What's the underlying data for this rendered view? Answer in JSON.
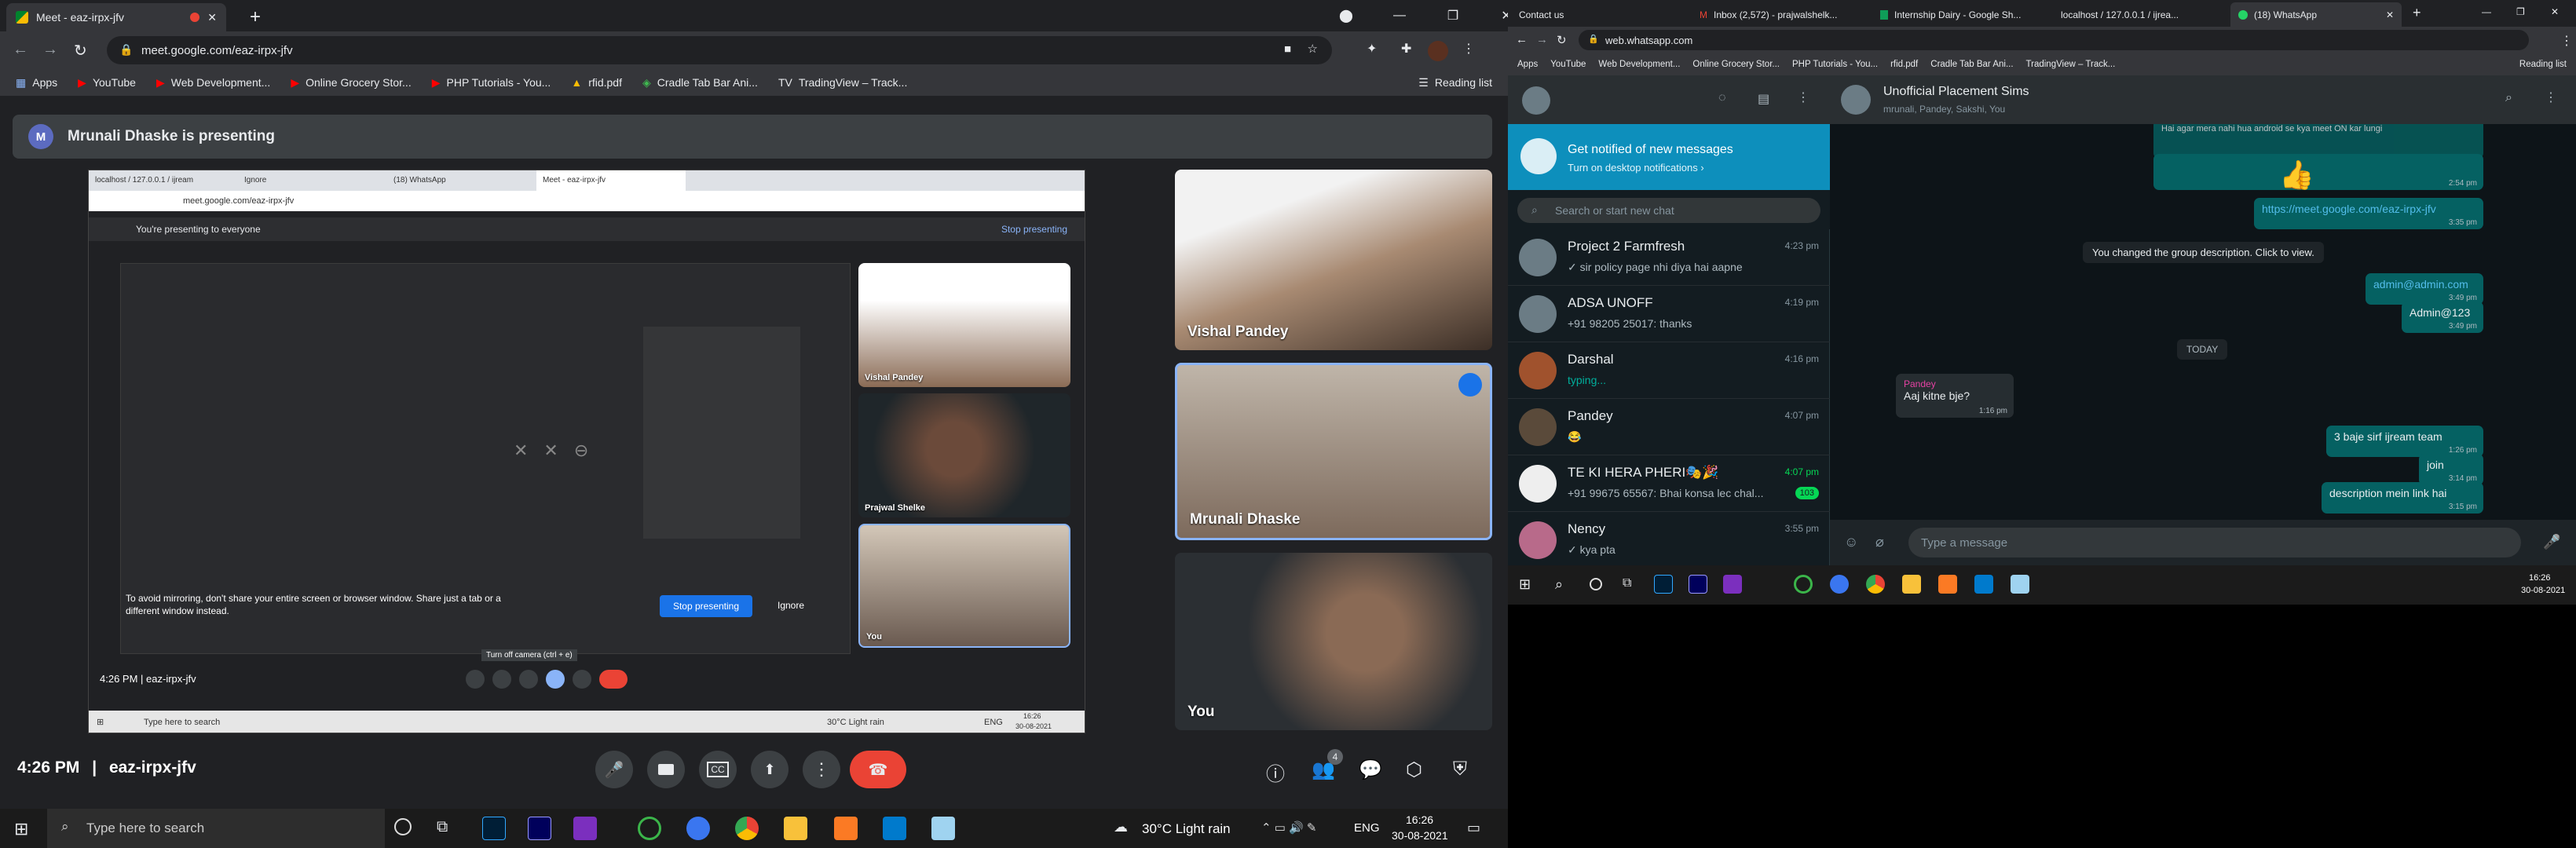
{
  "left_browser": {
    "tab_title": "Meet - eaz-irpx-jfv",
    "url": "meet.google.com/eaz-irpx-jfv",
    "reading_list": "Reading list",
    "bookmarks": [
      {
        "label": "Apps",
        "icon": "apps-grid-icon"
      },
      {
        "label": "YouTube",
        "icon": "youtube-icon"
      },
      {
        "label": "Web Development...",
        "icon": "youtube-icon"
      },
      {
        "label": "Online Grocery Stor...",
        "icon": "youtube-icon"
      },
      {
        "label": "PHP Tutorials - You...",
        "icon": "youtube-icon"
      },
      {
        "label": "rfid.pdf",
        "icon": "drive-icon"
      },
      {
        "label": "Cradle Tab Bar Ani...",
        "icon": "codepen-icon"
      },
      {
        "label": "TradingView – Track...",
        "icon": "tradingview-icon"
      }
    ]
  },
  "meet": {
    "presenter_initial": "M",
    "presenter_banner": "Mrunali Dhaske is presenting",
    "time": "4:26 PM",
    "meeting_code": "eaz-irpx-jfv",
    "participants_count": "4",
    "participants": [
      {
        "name": "Vishal Pandey"
      },
      {
        "name": "Mrunali Dhaske"
      },
      {
        "name": "You"
      }
    ],
    "shared_screen": {
      "tabs": [
        "localhost / 127.0.0.1 / ijream",
        "Ignore",
        "(18) WhatsApp",
        "Meet - eaz-irpx-jfv"
      ],
      "url": "meet.google.com/eaz-irpx-jfv",
      "banner": "You're presenting to everyone",
      "stop_link": "Stop presenting",
      "tile_names": [
        "Vishal Pandey",
        "Prajwal Shelke",
        "You"
      ],
      "mirror_warning": "To avoid mirroring, don't share your entire screen or browser window. Share just a tab or a different window instead.",
      "stop_button": "Stop presenting",
      "ignore_button": "Ignore",
      "time": "4:26 PM",
      "code": "eaz-irpx-jfv",
      "tooltip": "Turn off camera (ctrl + e)",
      "taskbar_search": "Type here to search",
      "weather": "30°C  Light rain",
      "lang": "ENG",
      "clock_time": "16:26",
      "clock_date": "30-08-2021"
    }
  },
  "left_taskbar": {
    "search_placeholder": "Type here to search",
    "weather": "30°C  Light rain",
    "lang": "ENG",
    "time": "16:26",
    "date": "30-08-2021"
  },
  "right_browser": {
    "tabs": [
      "Contact us",
      "Inbox (2,572) - prajwalshelk...",
      "Internship Dairy - Google Sh...",
      "localhost / 127.0.0.1 / ijrea...",
      "(18) WhatsApp"
    ],
    "url": "web.whatsapp.com",
    "reading_list": "Reading list",
    "bookmarks": [
      "Apps",
      "YouTube",
      "Web Development...",
      "Online Grocery Stor...",
      "PHP Tutorials - You...",
      "rfid.pdf",
      "Cradle Tab Bar Ani...",
      "TradingView – Track..."
    ]
  },
  "whatsapp": {
    "notify_title": "Get notified of new messages",
    "notify_sub": "Turn on desktop notifications ›",
    "search_placeholder": "Search or start new chat",
    "chats": [
      {
        "name": "Project 2 Farmfresh",
        "msg": "✓ sir policy page nhi diya hai aapne",
        "time": "4:23 pm",
        "unread": ""
      },
      {
        "name": "ADSA UNOFF",
        "msg": "+91 98205 25017: thanks",
        "time": "4:19 pm",
        "unread": ""
      },
      {
        "name": "Darshal",
        "msg": "typing...",
        "time": "4:16 pm",
        "unread": ""
      },
      {
        "name": "Pandey",
        "msg": "😂",
        "time": "4:07 pm",
        "unread": ""
      },
      {
        "name": "TE KI HERA PHERI🎭🎉",
        "msg": "+91 99675 65567: Bhai konsa lec chal...",
        "time": "4:07 pm",
        "unread": "103"
      },
      {
        "name": "Nency",
        "msg": "✓ kya pta",
        "time": "3:55 pm",
        "unread": ""
      }
    ],
    "group_name": "Unofficial Placement Sims",
    "group_members": "mrunali, Pandey, Sakshi, You",
    "messages": [
      {
        "dir": "out",
        "text": "Hai agar mera nahi hua android se kya meet ON kar lungi",
        "time": ""
      },
      {
        "dir": "out",
        "text": "👍",
        "time": "2:54 pm"
      },
      {
        "dir": "out",
        "text": "https://meet.google.com/eaz-irpx-jfv",
        "time": "3:35 pm"
      },
      {
        "dir": "sys",
        "text": "You changed the group description. Click to view.",
        "time": ""
      },
      {
        "dir": "out",
        "text": "admin@admin.com",
        "time": "3:49 pm"
      },
      {
        "dir": "out",
        "text": "Admin@123",
        "time": "3:49 pm"
      },
      {
        "dir": "sys",
        "text": "TODAY",
        "time": ""
      },
      {
        "dir": "in",
        "sender": "Pandey",
        "text": "Aaj kitne bje?",
        "time": "1:16 pm"
      },
      {
        "dir": "out",
        "text": "3 baje sirf ijream team",
        "time": "1:26 pm"
      },
      {
        "dir": "out",
        "text": "join",
        "time": "3:14 pm"
      },
      {
        "dir": "out",
        "text": "description mein link hai",
        "time": "3:15 pm"
      }
    ],
    "compose_placeholder": "Type a message"
  },
  "right_taskbar": {
    "time": "16:26",
    "date": "30-08-2021"
  }
}
